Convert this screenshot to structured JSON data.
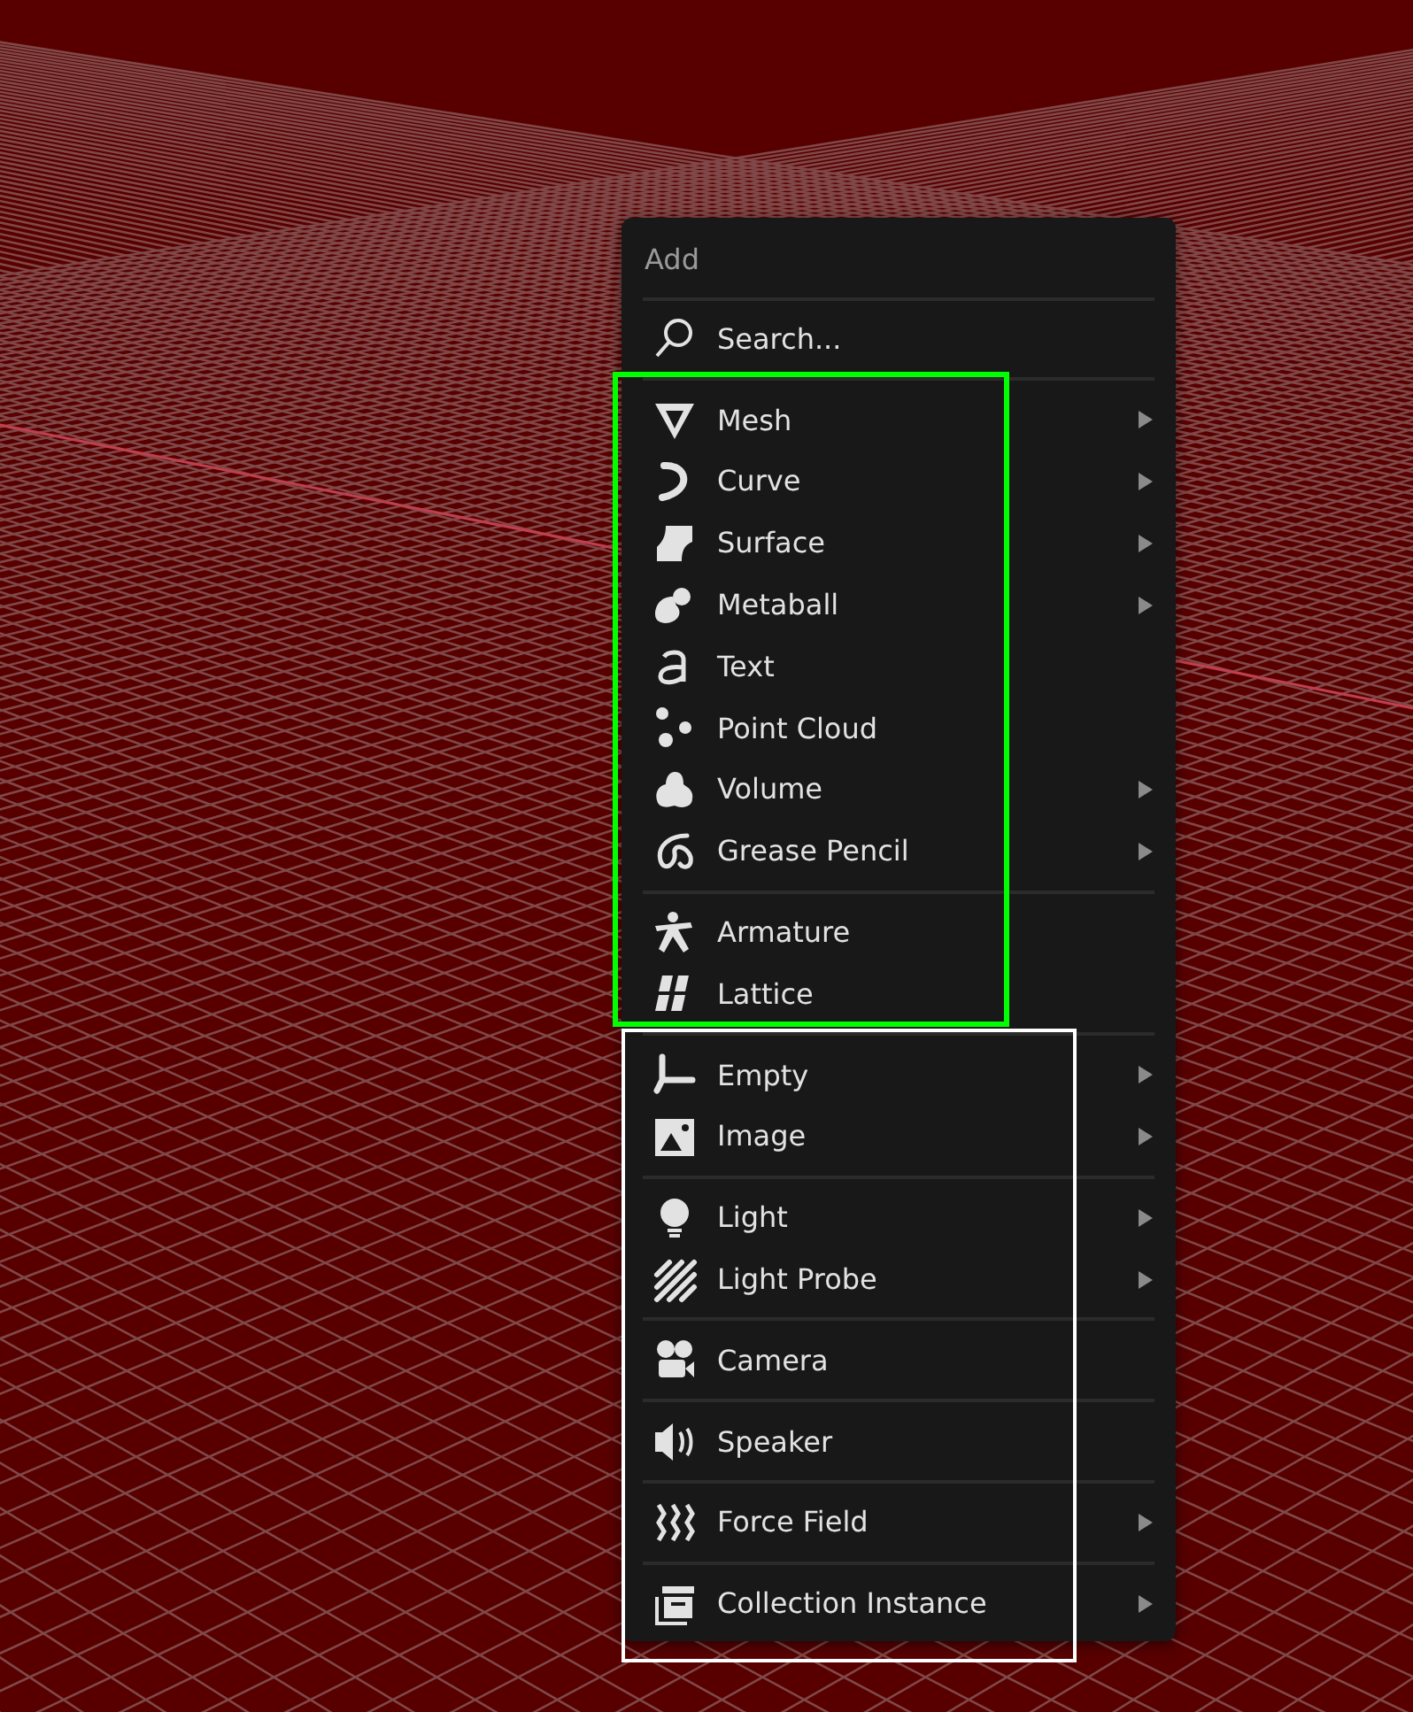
{
  "menu": {
    "title": "Add",
    "sections": [
      {
        "items": [
          {
            "label": "Search...",
            "kind": "search",
            "has_submenu": false
          }
        ]
      },
      {
        "items": [
          {
            "label": "Mesh",
            "kind": "mesh",
            "has_submenu": true
          },
          {
            "label": "Curve",
            "kind": "curve",
            "has_submenu": true
          },
          {
            "label": "Surface",
            "kind": "surface",
            "has_submenu": true
          },
          {
            "label": "Metaball",
            "kind": "metaball",
            "has_submenu": true
          },
          {
            "label": "Text",
            "kind": "text",
            "has_submenu": false
          },
          {
            "label": "Point Cloud",
            "kind": "point_cloud",
            "has_submenu": false
          },
          {
            "label": "Volume",
            "kind": "volume",
            "has_submenu": true
          },
          {
            "label": "Grease Pencil",
            "kind": "grease_pencil",
            "has_submenu": true
          }
        ]
      },
      {
        "items": [
          {
            "label": "Armature",
            "kind": "armature",
            "has_submenu": false
          },
          {
            "label": "Lattice",
            "kind": "lattice",
            "has_submenu": false
          }
        ]
      },
      {
        "items": [
          {
            "label": "Empty",
            "kind": "empty",
            "has_submenu": true
          },
          {
            "label": "Image",
            "kind": "image",
            "has_submenu": true
          }
        ]
      },
      {
        "items": [
          {
            "label": "Light",
            "kind": "light",
            "has_submenu": true
          },
          {
            "label": "Light Probe",
            "kind": "light_probe",
            "has_submenu": true
          }
        ]
      },
      {
        "items": [
          {
            "label": "Camera",
            "kind": "camera",
            "has_submenu": false
          }
        ]
      },
      {
        "items": [
          {
            "label": "Speaker",
            "kind": "speaker",
            "has_submenu": false
          }
        ]
      },
      {
        "items": [
          {
            "label": "Force Field",
            "kind": "force_field",
            "has_submenu": true
          }
        ]
      },
      {
        "items": [
          {
            "label": "Collection Instance",
            "kind": "collection_instance",
            "has_submenu": true
          }
        ]
      }
    ]
  },
  "highlights": [
    {
      "color": "#00ff00"
    },
    {
      "color": "#ffffff"
    }
  ]
}
